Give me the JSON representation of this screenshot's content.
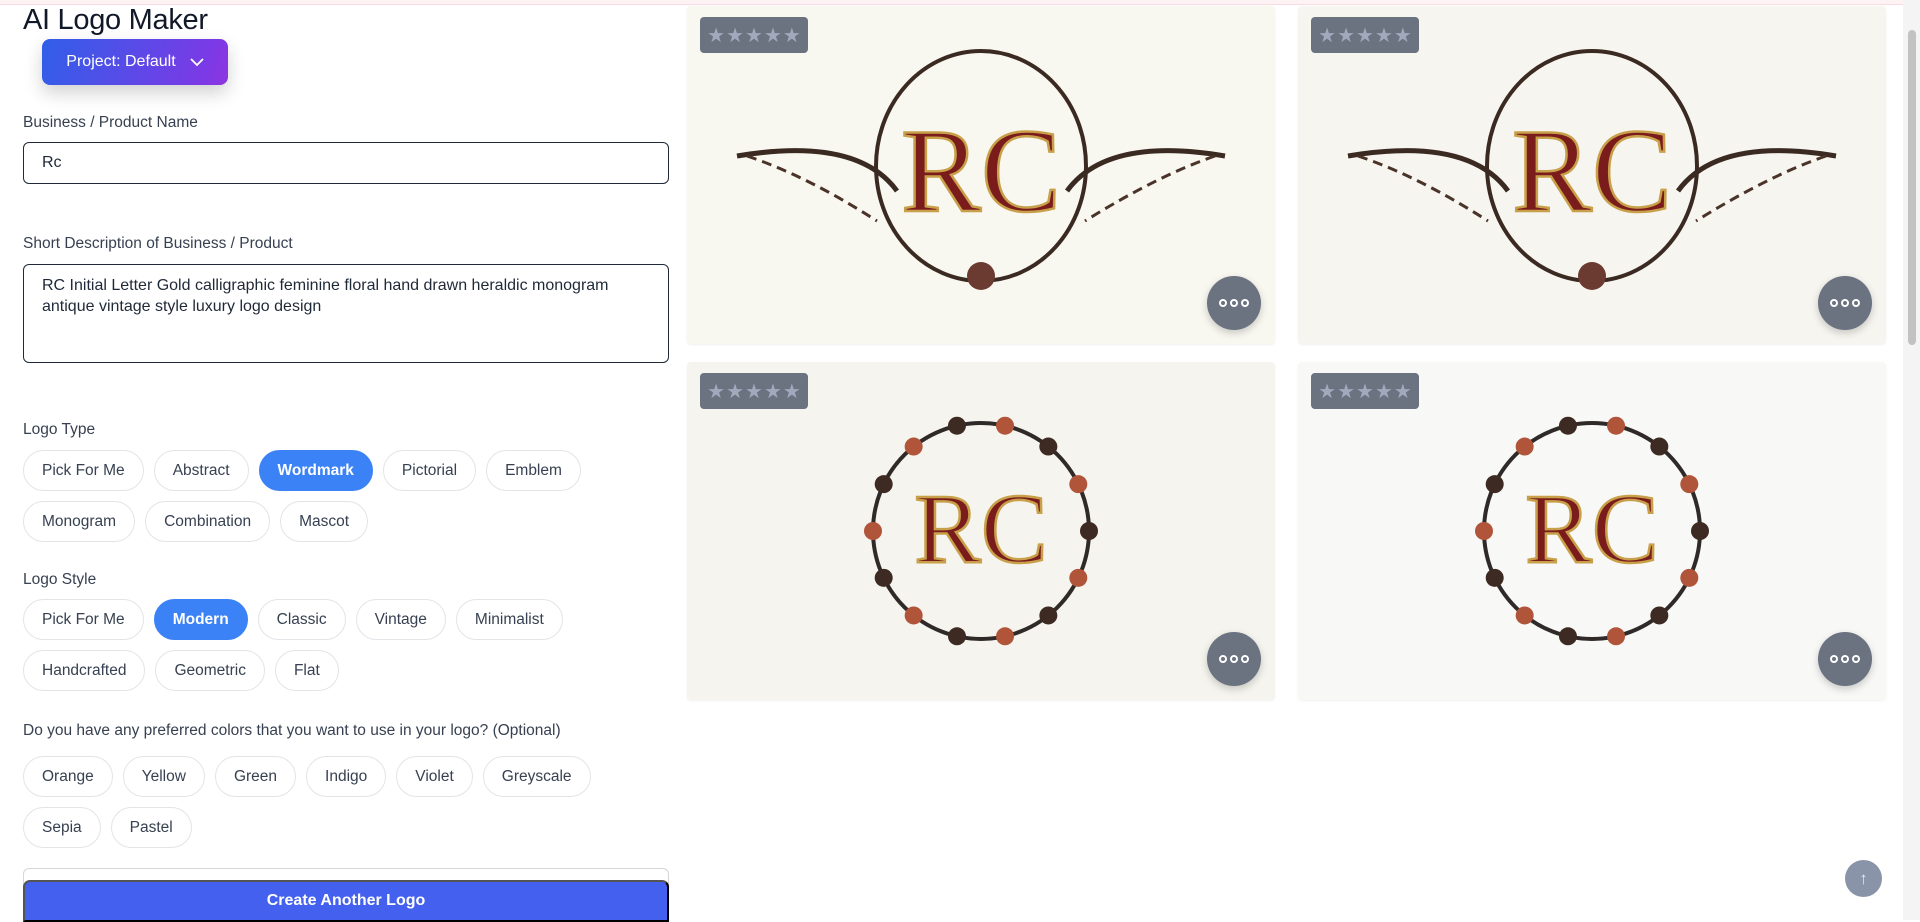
{
  "app": {
    "title": "AI Logo Maker",
    "project_label": "Project: Default"
  },
  "form": {
    "name_label": "Business / Product Name",
    "name_value": "Rc",
    "desc_label": "Short Description of Business / Product",
    "desc_value": "RC Initial Letter Gold calligraphic feminine floral hand drawn heraldic monogram antique vintage style luxury logo design",
    "logo_type_label": "Logo Type",
    "logo_types": [
      {
        "label": "Pick For Me"
      },
      {
        "label": "Abstract"
      },
      {
        "label": "Wordmark",
        "selected": true
      },
      {
        "label": "Pictorial"
      },
      {
        "label": "Emblem"
      },
      {
        "label": "Monogram"
      },
      {
        "label": "Combination"
      },
      {
        "label": "Mascot"
      }
    ],
    "logo_style_label": "Logo Style",
    "logo_styles": [
      {
        "label": "Pick For Me"
      },
      {
        "label": "Modern",
        "selected": true
      },
      {
        "label": "Classic"
      },
      {
        "label": "Vintage"
      },
      {
        "label": "Minimalist"
      },
      {
        "label": "Handcrafted"
      },
      {
        "label": "Geometric"
      },
      {
        "label": "Flat"
      }
    ],
    "colors_label": "Do you have any preferred colors that you want to use in your logo? (Optional)",
    "colors": [
      {
        "label": "Orange"
      },
      {
        "label": "Yellow"
      },
      {
        "label": "Green"
      },
      {
        "label": "Indigo"
      },
      {
        "label": "Violet"
      },
      {
        "label": "Greyscale"
      },
      {
        "label": "Sepia"
      },
      {
        "label": "Pastel"
      }
    ],
    "create_label": "Create Another Logo"
  },
  "results": [
    {
      "monogram": "RC",
      "rating": 0,
      "background": "#f8f7f0"
    },
    {
      "monogram": "RC",
      "rating": 0,
      "background": "#f6f5f0"
    },
    {
      "monogram": "RC",
      "rating": 0,
      "background": "#f5f4ee"
    },
    {
      "monogram": "RC",
      "rating": 0,
      "background": "#f8f8f6"
    }
  ],
  "colors": {
    "accent": "#3b82f6",
    "create_button": "#4361ee",
    "project_gradient": [
      "#2f5fe8",
      "#8e35e0"
    ]
  }
}
